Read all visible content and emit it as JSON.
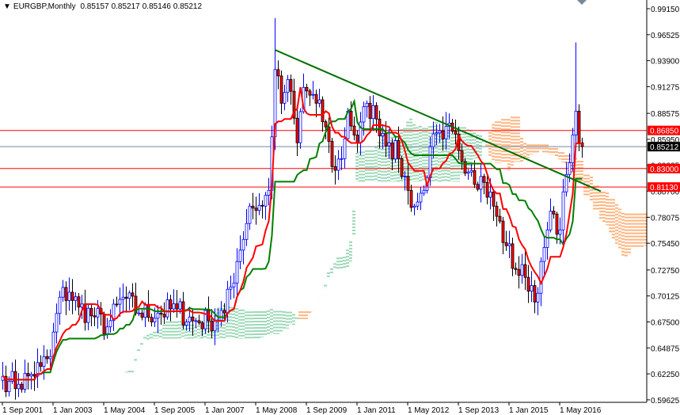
{
  "header": {
    "symbol": "EURGBP,Monthly",
    "open": "0.85157",
    "high": "0.85217",
    "low": "0.85146",
    "close": "0.85212"
  },
  "chart_data": {
    "type": "candlestick",
    "title": "EURGBP,Monthly",
    "ylim": [
      0.59625,
      0.9915
    ],
    "y_ticks": [
      "0.99150",
      "0.96525",
      "0.93900",
      "0.91275",
      "0.88575",
      "0.85950",
      "0.83325",
      "0.80700",
      "0.78075",
      "0.75450",
      "0.72750",
      "0.70125",
      "0.67500",
      "0.64875",
      "0.62250",
      "0.59625"
    ],
    "x_ticks": [
      "1 Sep 2001",
      "1 Jan 2003",
      "1 May 2004",
      "1 Sep 2005",
      "1 Jan 2007",
      "1 May 2008",
      "1 Sep 2009",
      "1 Jan 2011",
      "1 May 2012",
      "1 Sep 2013",
      "1 Jan 2015",
      "1 May 2016"
    ],
    "start_month": "Sep 2001",
    "close_keypoints_month_index_price": [
      [
        0,
        0.62
      ],
      [
        2,
        0.615
      ],
      [
        5,
        0.612
      ],
      [
        9,
        0.622
      ],
      [
        12,
        0.63
      ],
      [
        15,
        0.64
      ],
      [
        18,
        0.7
      ],
      [
        21,
        0.705
      ],
      [
        24,
        0.69
      ],
      [
        29,
        0.68
      ],
      [
        33,
        0.67
      ],
      [
        38,
        0.7
      ],
      [
        43,
        0.684
      ],
      [
        49,
        0.684
      ],
      [
        55,
        0.688
      ],
      [
        60,
        0.676
      ],
      [
        65,
        0.676
      ],
      [
        70,
        0.684
      ],
      [
        74,
        0.736
      ],
      [
        78,
        0.792
      ],
      [
        82,
        0.792
      ],
      [
        84,
        0.808
      ],
      [
        86,
        0.93
      ],
      [
        88,
        0.896
      ],
      [
        90,
        0.92
      ],
      [
        93,
        0.856
      ],
      [
        95,
        0.912
      ],
      [
        99,
        0.896
      ],
      [
        102,
        0.872
      ],
      [
        104,
        0.832
      ],
      [
        107,
        0.84
      ],
      [
        109,
        0.888
      ],
      [
        112,
        0.856
      ],
      [
        115,
        0.896
      ],
      [
        118,
        0.88
      ],
      [
        122,
        0.856
      ],
      [
        125,
        0.84
      ],
      [
        128,
        0.808
      ],
      [
        130,
        0.792
      ],
      [
        133,
        0.808
      ],
      [
        135,
        0.852
      ],
      [
        139,
        0.86
      ],
      [
        142,
        0.868
      ],
      [
        144,
        0.848
      ],
      [
        148,
        0.828
      ],
      [
        152,
        0.816
      ],
      [
        155,
        0.792
      ],
      [
        159,
        0.752
      ],
      [
        162,
        0.728
      ],
      [
        165,
        0.72
      ],
      [
        169,
        0.704
      ],
      [
        172,
        0.768
      ],
      [
        174,
        0.784
      ],
      [
        176,
        0.768
      ],
      [
        178,
        0.824
      ],
      [
        180,
        0.864
      ],
      [
        181,
        0.888
      ],
      [
        182,
        0.856
      ],
      [
        183,
        0.85212
      ]
    ],
    "high_overrides": [
      [
        86,
        0.982
      ],
      [
        181,
        0.9575
      ]
    ],
    "indicators": [
      "Ichimoku tenkan (red)",
      "Ichimoku kijun (green)",
      "Ichimoku cloud (dotted)"
    ],
    "trendline": {
      "from": [
        86,
        0.95
      ],
      "to": [
        189,
        0.807
      ]
    },
    "levels": [
      {
        "price": "0.86850",
        "color": "#ff0000"
      },
      {
        "price": "0.83000",
        "color": "#ff0000"
      },
      {
        "price": "0.81130",
        "color": "#ff0000"
      }
    ],
    "current_price": "0.85212",
    "colors": {
      "up": "#0000ff",
      "down": "#ff0000",
      "tenkan": "#ff0000",
      "kijun": "#008000",
      "cloud_bull": "#3cb371",
      "cloud_bear": "#ff6a00",
      "trend": "#007000"
    }
  }
}
